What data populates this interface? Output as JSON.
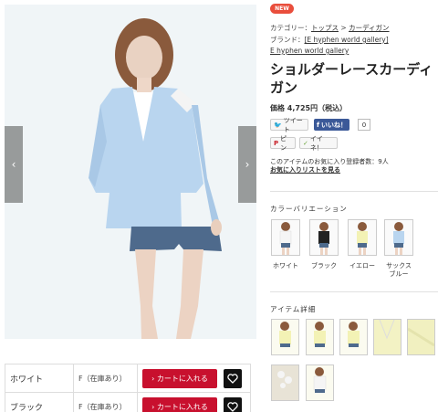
{
  "badge": "NEW",
  "category": {
    "label": "カテゴリー：",
    "crumb1": "トップス",
    "sep": ">",
    "crumb2": "カーディガン"
  },
  "brand": {
    "label": "ブランド：",
    "value": "[E hyphen world gallery]",
    "line2": "E hyphen world gallery"
  },
  "product": {
    "title": "ショルダーレースカーディガン",
    "price": "価格 4,725円（税込）"
  },
  "social": {
    "tweet": "ツイート",
    "like": "いいね！",
    "like_count": "0",
    "pin": "ピン",
    "iine": "イイネ！"
  },
  "favorites": {
    "count_text": "このアイテムのお気に入り登録者数：9人",
    "link": "お気に入りリストを見る"
  },
  "variation": {
    "title": "カラーバリエーション",
    "items": [
      {
        "label": "ホワイト"
      },
      {
        "label": "ブラック"
      },
      {
        "label": "イエロー"
      },
      {
        "label": "サックス\nブルー"
      }
    ]
  },
  "detail": {
    "title": "アイテム詳細"
  },
  "availability": {
    "rows": [
      {
        "color": "ホワイト",
        "stock": "F（在庫あり）",
        "cart": "カートに入れる"
      },
      {
        "color": "ブラック",
        "stock": "F（在庫あり）",
        "cart": "カートに入れる"
      }
    ]
  },
  "colors": {
    "cart": "#c8102e",
    "badge": "#e94e3c",
    "facebook": "#3b5998",
    "cardigan": "#b9d5ef"
  }
}
